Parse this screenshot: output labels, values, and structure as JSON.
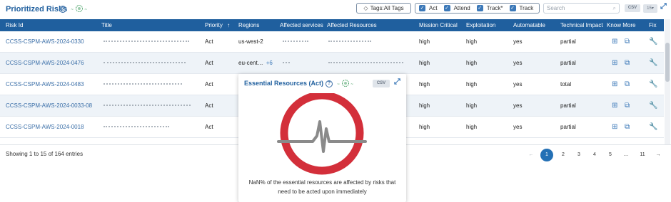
{
  "header": {
    "title": "Prioritized Risks",
    "help_icon": "help-circle-icon",
    "logo_icon": "globe-tag-icon",
    "tags_label": "Tags:All Tags",
    "checks": [
      {
        "label": "Act",
        "checked": true
      },
      {
        "label": "Attend",
        "checked": true
      },
      {
        "label": "Track*",
        "checked": true
      },
      {
        "label": "Track",
        "checked": true
      }
    ],
    "search_placeholder": "Search",
    "csv_label": "CSV",
    "page_size": "15"
  },
  "table": {
    "columns": [
      "Risk Id",
      "Title",
      "Priority",
      "Regions",
      "Affected services",
      "Affected Resources",
      "Mission Critical",
      "Exploitation",
      "Automatable",
      "Technical Impact",
      "Know More",
      "Fix"
    ],
    "sort_arrow": "↑",
    "rows": [
      {
        "risk_id": "CCSS-CSPM-AWS-2024-0330",
        "priority": "Act",
        "region": "us-west-2",
        "region_more": "",
        "mission_critical": "high",
        "exploitation": "high",
        "automatable": "yes",
        "technical_impact": "partial"
      },
      {
        "risk_id": "CCSS-CSPM-AWS-2024-0476",
        "priority": "Act",
        "region": "eu-cent…",
        "region_more": "+6",
        "mission_critical": "high",
        "exploitation": "high",
        "automatable": "yes",
        "technical_impact": "partial"
      },
      {
        "risk_id": "CCSS-CSPM-AWS-2024-0483",
        "priority": "Act",
        "region": "",
        "region_more": "",
        "mission_critical": "high",
        "exploitation": "high",
        "automatable": "yes",
        "technical_impact": "total"
      },
      {
        "risk_id": "CCSS-CSPM-AWS-2024-0033-08",
        "priority": "Act",
        "region": "",
        "region_more": "",
        "mission_critical": "high",
        "exploitation": "high",
        "automatable": "yes",
        "technical_impact": "partial"
      },
      {
        "risk_id": "CCSS-CSPM-AWS-2024-0018",
        "priority": "Act",
        "region": "",
        "region_more": "",
        "mission_critical": "high",
        "exploitation": "high",
        "automatable": "yes",
        "technical_impact": "partial"
      }
    ]
  },
  "footer": {
    "entries_text": "Showing 1 to 15 of 164 entries",
    "prev": "←",
    "pages": [
      "1",
      "2",
      "3",
      "4",
      "5",
      "…",
      "11"
    ],
    "current_page": "1",
    "next": "→"
  },
  "popup": {
    "title": "Essential Resources (Act)",
    "csv_label": "CSV",
    "ring_color": "#d32f3a",
    "line1": "NaN% of the essential resources are affected by risks that",
    "line2": "need to be acted upon immediately"
  }
}
